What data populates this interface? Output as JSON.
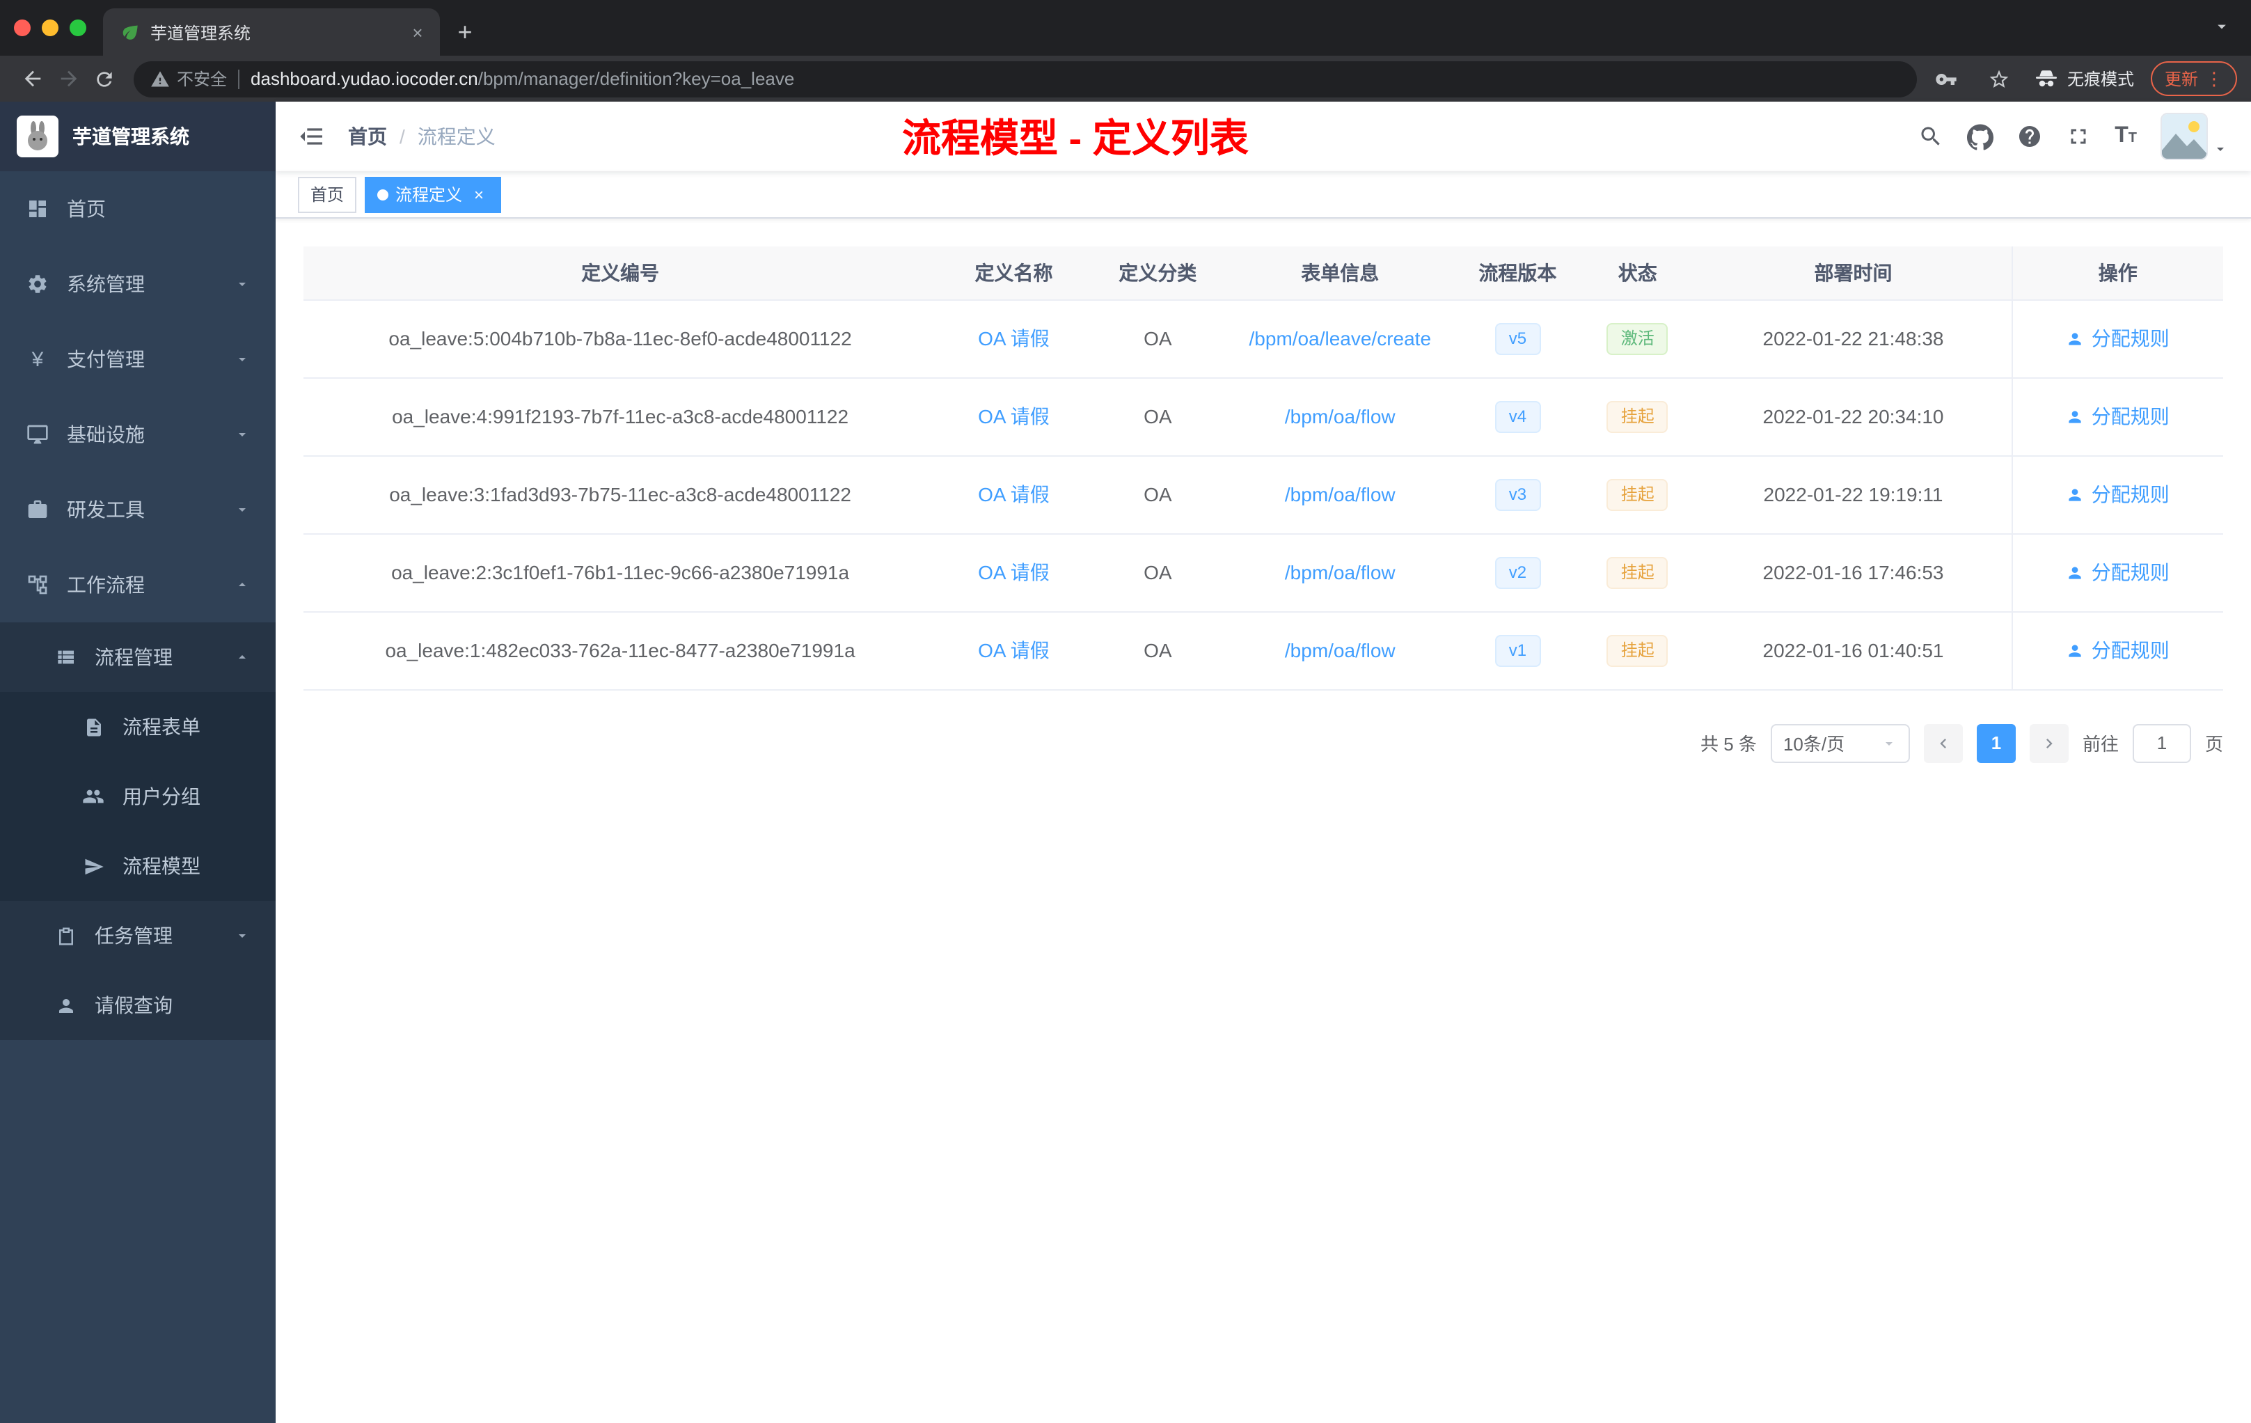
{
  "browser": {
    "tab_title": "芋道管理系统",
    "security_label": "不安全",
    "url_host": "dashboard.yudao.iocoder.cn",
    "url_path": "/bpm/manager/definition?key=oa_leave",
    "incognito_label": "无痕模式",
    "update_label": "更新"
  },
  "icons": {
    "close": "×",
    "plus": "+",
    "kebab": "⋮",
    "yen": "¥"
  },
  "sidebar": {
    "logo_title": "芋道管理系统",
    "items": [
      {
        "label": "首页",
        "icon": "dashboard-icon"
      },
      {
        "label": "系统管理",
        "icon": "gear-icon"
      },
      {
        "label": "支付管理",
        "icon": "yen-icon"
      },
      {
        "label": "基础设施",
        "icon": "infrastructure-icon"
      },
      {
        "label": "研发工具",
        "icon": "tools-icon"
      },
      {
        "label": "工作流程",
        "icon": "workflow-icon"
      }
    ],
    "process_group": {
      "label": "流程管理",
      "icon": "list-icon"
    },
    "process_children": [
      {
        "label": "流程表单",
        "icon": "form-icon"
      },
      {
        "label": "用户分组",
        "icon": "user-group-icon"
      },
      {
        "label": "流程模型",
        "icon": "paper-plane-icon"
      }
    ],
    "task_group": {
      "label": "任务管理",
      "icon": "clipboard-icon"
    },
    "leave_item": {
      "label": "请假查询",
      "icon": "person-icon"
    }
  },
  "navbar": {
    "breadcrumb_home": "首页",
    "breadcrumb_separator": "/",
    "breadcrumb_current": "流程定义",
    "annotation": "流程模型 - 定义列表"
  },
  "tags": {
    "home": "首页",
    "active": "流程定义"
  },
  "table": {
    "headers": {
      "id": "定义编号",
      "name": "定义名称",
      "category": "定义分类",
      "form": "表单信息",
      "version": "流程版本",
      "status": "状态",
      "deploy_time": "部署时间",
      "actions": "操作"
    },
    "rows": [
      {
        "id": "oa_leave:5:004b710b-7b8a-11ec-8ef0-acde48001122",
        "name": "OA 请假",
        "category": "OA",
        "form": "/bpm/oa/leave/create",
        "version": "v5",
        "status": "激活",
        "deploy_time": "2022-01-22 21:48:38",
        "action": "分配规则"
      },
      {
        "id": "oa_leave:4:991f2193-7b7f-11ec-a3c8-acde48001122",
        "name": "OA 请假",
        "category": "OA",
        "form": "/bpm/oa/flow",
        "version": "v4",
        "status": "挂起",
        "deploy_time": "2022-01-22 20:34:10",
        "action": "分配规则"
      },
      {
        "id": "oa_leave:3:1fad3d93-7b75-11ec-a3c8-acde48001122",
        "name": "OA 请假",
        "category": "OA",
        "form": "/bpm/oa/flow",
        "version": "v3",
        "status": "挂起",
        "deploy_time": "2022-01-22 19:19:11",
        "action": "分配规则"
      },
      {
        "id": "oa_leave:2:3c1f0ef1-76b1-11ec-9c66-a2380e71991a",
        "name": "OA 请假",
        "category": "OA",
        "form": "/bpm/oa/flow",
        "version": "v2",
        "status": "挂起",
        "deploy_time": "2022-01-16 17:46:53",
        "action": "分配规则"
      },
      {
        "id": "oa_leave:1:482ec033-762a-11ec-8477-a2380e71991a",
        "name": "OA 请假",
        "category": "OA",
        "form": "/bpm/oa/flow",
        "version": "v1",
        "status": "挂起",
        "deploy_time": "2022-01-16 01:40:51",
        "action": "分配规则"
      }
    ]
  },
  "pagination": {
    "total": "共 5 条",
    "page_size": "10条/页",
    "page": "1",
    "goto_label": "前往",
    "goto_value": "1",
    "unit_label": "页"
  },
  "colors": {
    "primary": "#409eff",
    "success": "#67c23a",
    "warning": "#e6a23c",
    "annotation_red": "#ff0000",
    "sidebar_bg": "#304156"
  }
}
